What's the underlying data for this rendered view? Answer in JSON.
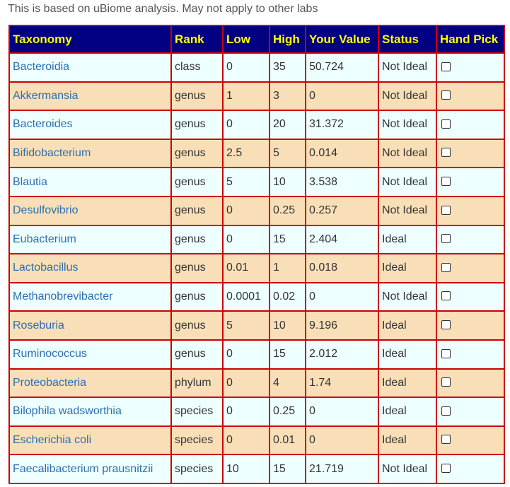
{
  "note": "This is based on uBiome analysis. May not apply to other labs",
  "table": {
    "headers": [
      "Taxonomy",
      "Rank",
      "Low",
      "High",
      "Your Value",
      "Status",
      "Hand Pick"
    ],
    "rows": [
      {
        "taxonomy": "Bacteroidia",
        "rank": "class",
        "low": "0",
        "high": "35",
        "value": "50.724",
        "status": "Not Ideal",
        "hand_pick": false
      },
      {
        "taxonomy": "Akkermansia",
        "rank": "genus",
        "low": "1",
        "high": "3",
        "value": "0",
        "status": "Not Ideal",
        "hand_pick": false
      },
      {
        "taxonomy": "Bacteroides",
        "rank": "genus",
        "low": "0",
        "high": "20",
        "value": "31.372",
        "status": "Not Ideal",
        "hand_pick": false
      },
      {
        "taxonomy": "Bifidobacterium",
        "rank": "genus",
        "low": "2.5",
        "high": "5",
        "value": "0.014",
        "status": "Not Ideal",
        "hand_pick": false
      },
      {
        "taxonomy": "Blautia",
        "rank": "genus",
        "low": "5",
        "high": "10",
        "value": "3.538",
        "status": "Not Ideal",
        "hand_pick": false
      },
      {
        "taxonomy": "Desulfovibrio",
        "rank": "genus",
        "low": "0",
        "high": "0.25",
        "value": "0.257",
        "status": "Not Ideal",
        "hand_pick": false
      },
      {
        "taxonomy": "Eubacterium",
        "rank": "genus",
        "low": "0",
        "high": "15",
        "value": "2.404",
        "status": "Ideal",
        "hand_pick": false
      },
      {
        "taxonomy": "Lactobacillus",
        "rank": "genus",
        "low": "0.01",
        "high": "1",
        "value": "0.018",
        "status": "Ideal",
        "hand_pick": false
      },
      {
        "taxonomy": "Methanobrevibacter",
        "rank": "genus",
        "low": "0.0001",
        "high": "0.02",
        "value": "0",
        "status": "Not Ideal",
        "hand_pick": false
      },
      {
        "taxonomy": "Roseburia",
        "rank": "genus",
        "low": "5",
        "high": "10",
        "value": "9.196",
        "status": "Ideal",
        "hand_pick": false
      },
      {
        "taxonomy": "Ruminococcus",
        "rank": "genus",
        "low": "0",
        "high": "15",
        "value": "2.012",
        "status": "Ideal",
        "hand_pick": false
      },
      {
        "taxonomy": "Proteobacteria",
        "rank": "phylum",
        "low": "0",
        "high": "4",
        "value": "1.74",
        "status": "Ideal",
        "hand_pick": false
      },
      {
        "taxonomy": "Bilophila wadsworthia",
        "rank": "species",
        "low": "0",
        "high": "0.25",
        "value": "0",
        "status": "Ideal",
        "hand_pick": false
      },
      {
        "taxonomy": "Escherichia coli",
        "rank": "species",
        "low": "0",
        "high": "0.01",
        "value": "0",
        "status": "Ideal",
        "hand_pick": false
      },
      {
        "taxonomy": "Faecalibacterium prausnitzii",
        "rank": "species",
        "low": "10",
        "high": "15",
        "value": "21.719",
        "status": "Not Ideal",
        "hand_pick": false
      }
    ]
  },
  "colors": {
    "header_bg": "#000080",
    "header_text": "#ffff00",
    "border": "#cc0000",
    "row_odd": "#eeffff",
    "row_even": "#f8dfb8",
    "link": "#2c6fb0"
  }
}
